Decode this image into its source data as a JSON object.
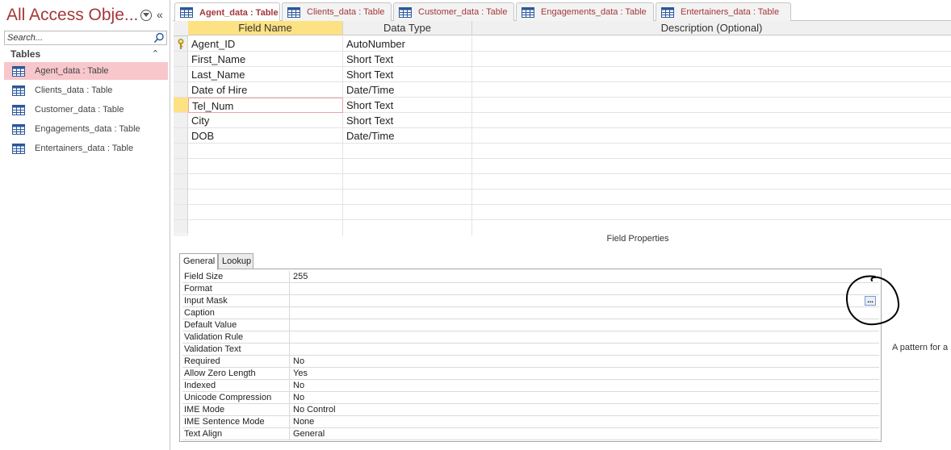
{
  "nav": {
    "title": "All Access Obje...",
    "search_placeholder": "Search...",
    "group_label": "Tables",
    "items": [
      {
        "label": "Agent_data : Table",
        "active": true
      },
      {
        "label": "Clients_data : Table",
        "active": false
      },
      {
        "label": "Customer_data : Table",
        "active": false
      },
      {
        "label": "Engagements_data : Table",
        "active": false
      },
      {
        "label": "Entertainers_data : Table",
        "active": false
      }
    ]
  },
  "tabs": [
    {
      "label": "Agent_data : Table",
      "active": true
    },
    {
      "label": "Clients_data : Table",
      "active": false
    },
    {
      "label": "Customer_data : Table",
      "active": false
    },
    {
      "label": "Engagements_data : Table",
      "active": false
    },
    {
      "label": "Entertainers_data : Table",
      "active": false
    }
  ],
  "grid": {
    "headers": {
      "field_name": "Field Name",
      "data_type": "Data Type",
      "description": "Description (Optional)"
    },
    "rows": [
      {
        "name": "Agent_ID",
        "type": "AutoNumber"
      },
      {
        "name": "First_Name",
        "type": "Short Text"
      },
      {
        "name": "Last_Name",
        "type": "Short Text"
      },
      {
        "name": "Date of Hire",
        "type": "Date/Time"
      },
      {
        "name": "Tel_Num",
        "type": "Short Text"
      },
      {
        "name": "City",
        "type": "Short Text"
      },
      {
        "name": "DOB",
        "type": "Date/Time"
      }
    ]
  },
  "field_properties": {
    "title": "Field Properties",
    "tabs": {
      "general": "General",
      "lookup": "Lookup"
    },
    "rows": [
      {
        "label": "Field Size",
        "value": "255"
      },
      {
        "label": "Format",
        "value": ""
      },
      {
        "label": "Input Mask",
        "value": ""
      },
      {
        "label": "Caption",
        "value": ""
      },
      {
        "label": "Default Value",
        "value": ""
      },
      {
        "label": "Validation Rule",
        "value": ""
      },
      {
        "label": "Validation Text",
        "value": ""
      },
      {
        "label": "Required",
        "value": "No"
      },
      {
        "label": "Allow Zero Length",
        "value": "Yes"
      },
      {
        "label": "Indexed",
        "value": "No"
      },
      {
        "label": "Unicode Compression",
        "value": "No"
      },
      {
        "label": "IME Mode",
        "value": "No Control"
      },
      {
        "label": "IME Sentence Mode",
        "value": "None"
      },
      {
        "label": "Text Align",
        "value": "General"
      }
    ],
    "builder_button": "...",
    "help_text": "A pattern for a"
  },
  "colors": {
    "accent": "#a4373a",
    "selection": "#fde283",
    "nav_active": "#f8c7cb"
  }
}
